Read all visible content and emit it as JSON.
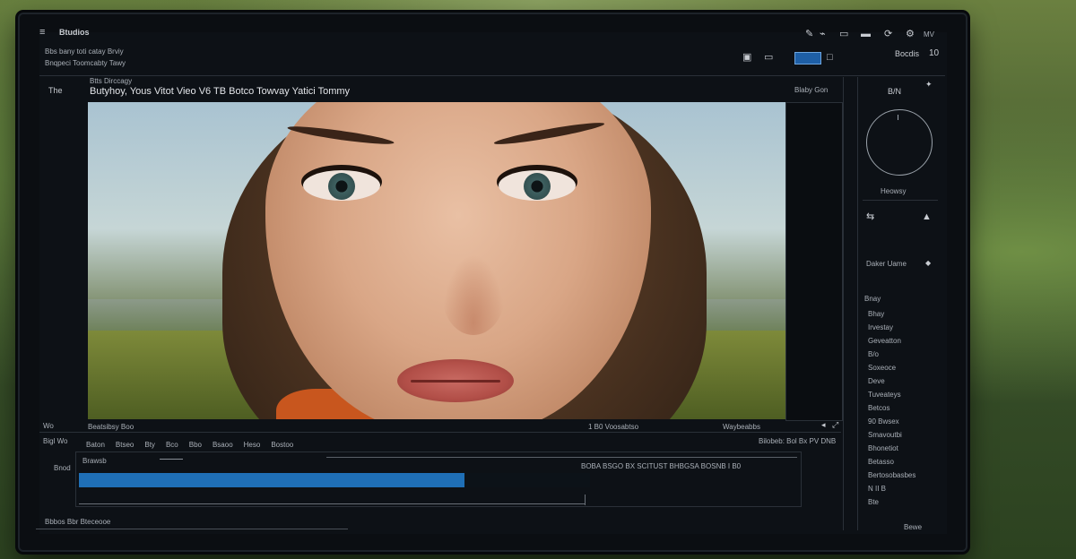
{
  "app": {
    "title": "Btudios",
    "subtitle_line1": "Bbs bany toti catay Brviy",
    "subtitle_line2": "Bnqpeci Toomcabty Tawy"
  },
  "toolbar": {
    "right_label": "Bocdis",
    "right_value": "10"
  },
  "header": {
    "left_label": "The",
    "caption_small": "Btts Dirccagy",
    "title": "Butyhoy, Yous Vitot Vieo V6 TB Botco Towvay Yatici Tommy",
    "right_label": "Blaby Gon"
  },
  "preview": {
    "left_label": "Wo",
    "bottom_left": "Beatsibsy Boo",
    "bottom_mid": "1 B0  Voosabtso",
    "bottom_right": "Waybeabbs"
  },
  "right_panel": {
    "title": "B/N",
    "dial_label": "Heowsy",
    "item1": "Daker Uame",
    "section": "Bnay",
    "list": [
      "Bhay",
      "Irvestay",
      "Geveatton",
      "B/o",
      "Soxeoce",
      "Deve",
      "Tuveateys",
      "Betcos",
      "90 Bwsex",
      "Smavoutbi",
      "Bhonetiot",
      "Betasso",
      "Bertosobasbes",
      "N II B",
      "Bte"
    ],
    "footer_label": "Bewe"
  },
  "timeline": {
    "label": "Bigl Wo",
    "tabs": [
      "Baton",
      "Btseo",
      "Bty",
      "Bco",
      "Bbo",
      "Bsaoo",
      "Heso",
      "Bostoo"
    ],
    "right_label": "Bilobeb: Bol Bx PV DNB",
    "row_label": "Bnod",
    "track_label": "Brawsb",
    "meta_text": "BOBA BSGO BX  SCITUST  BHBGSA  BOSNB I B0",
    "progress": 0.755,
    "footer_label": "Bbbos Bbr Bteceooe"
  },
  "colors": {
    "accent": "#1f6fb6",
    "panel_bg": "#0d1116",
    "text": "#c8ccd2"
  }
}
